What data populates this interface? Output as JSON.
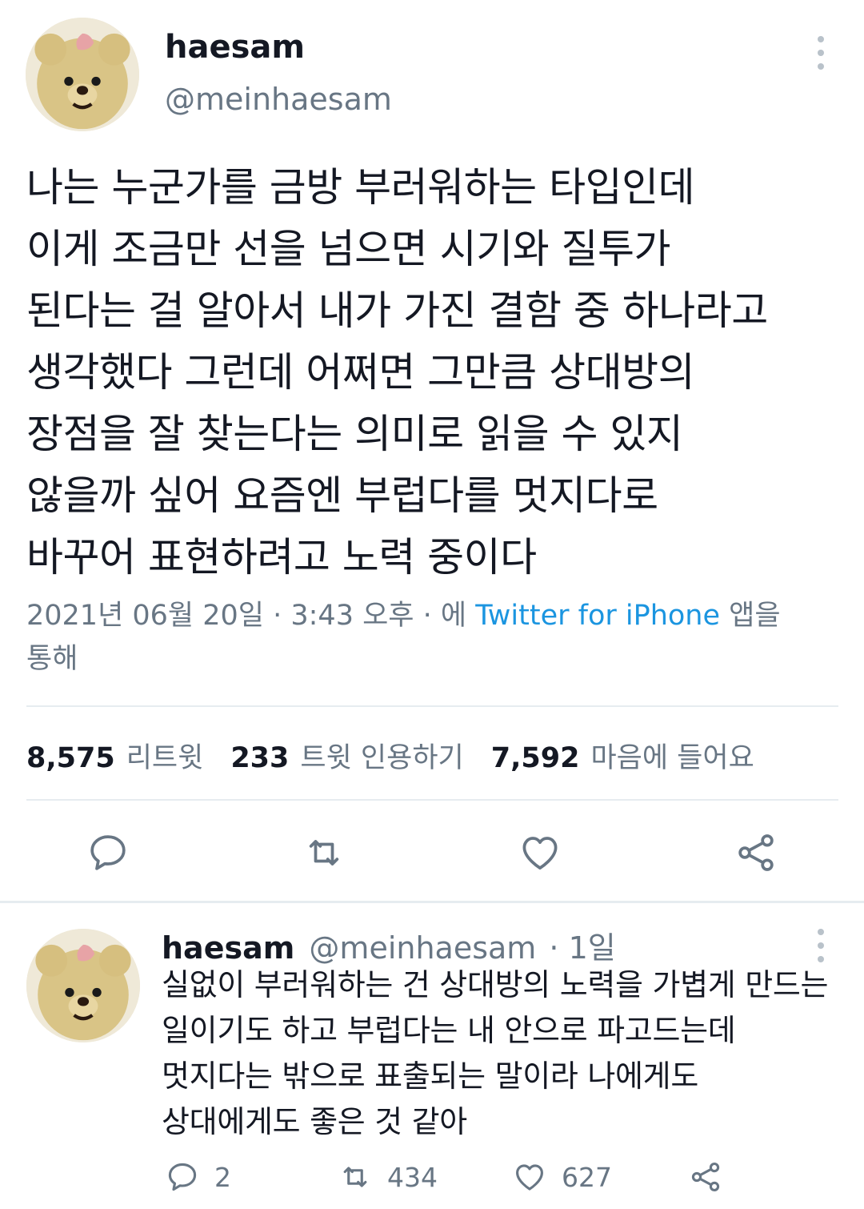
{
  "tweet": {
    "display_name": "haesam",
    "handle": "@meinhaesam",
    "body_lines": [
      "나는 누군가를 금방 부러워하는 타입인데",
      "이게 조금만 선을 넘으면 시기와 질투가",
      "된다는 걸 알아서 내가 가진 결함 중 하나라고",
      "생각했다 그런데 어쩌면 그만큼 상대방의",
      "장점을 잘 찾는다는 의미로 읽을 수 있지",
      "않을까 싶어 요즘엔 부럽다를 멋지다로",
      "바꾸어 표현하려고 노력 중이다"
    ],
    "meta_prefix": "2021년 06월 20일 · 3:43 오후 · 에 ",
    "meta_source": "Twitter for iPhone",
    "meta_suffix": " 앱을",
    "meta_line2": "통해",
    "stats": {
      "retweets_count": "8,575",
      "retweets_label": "리트윗",
      "quotes_count": "233",
      "quotes_label": "트윗 인용하기",
      "likes_count": "7,592",
      "likes_label": "마음에 들어요"
    },
    "actions": [
      "reply-icon",
      "retweet-icon",
      "heart-icon",
      "share-icon"
    ]
  },
  "reply": {
    "display_name": "haesam",
    "handle": "@meinhaesam",
    "time": "· 1일",
    "body_lines": [
      "실없이 부러워하는 건 상대방의 노력을 가볍게 만드는",
      "일이기도 하고 부럽다는 내 안으로 파고드는데",
      "멋지다는 밖으로 표출되는 말이라 나에게도",
      "상대에게도 좋은 것 같아"
    ],
    "reply_count": "2",
    "retweet_count": "434",
    "like_count": "627"
  },
  "colors": {
    "text": "#141823",
    "muted": "#687684",
    "link": "#1b95e0",
    "divider": "#e6ecf0"
  }
}
